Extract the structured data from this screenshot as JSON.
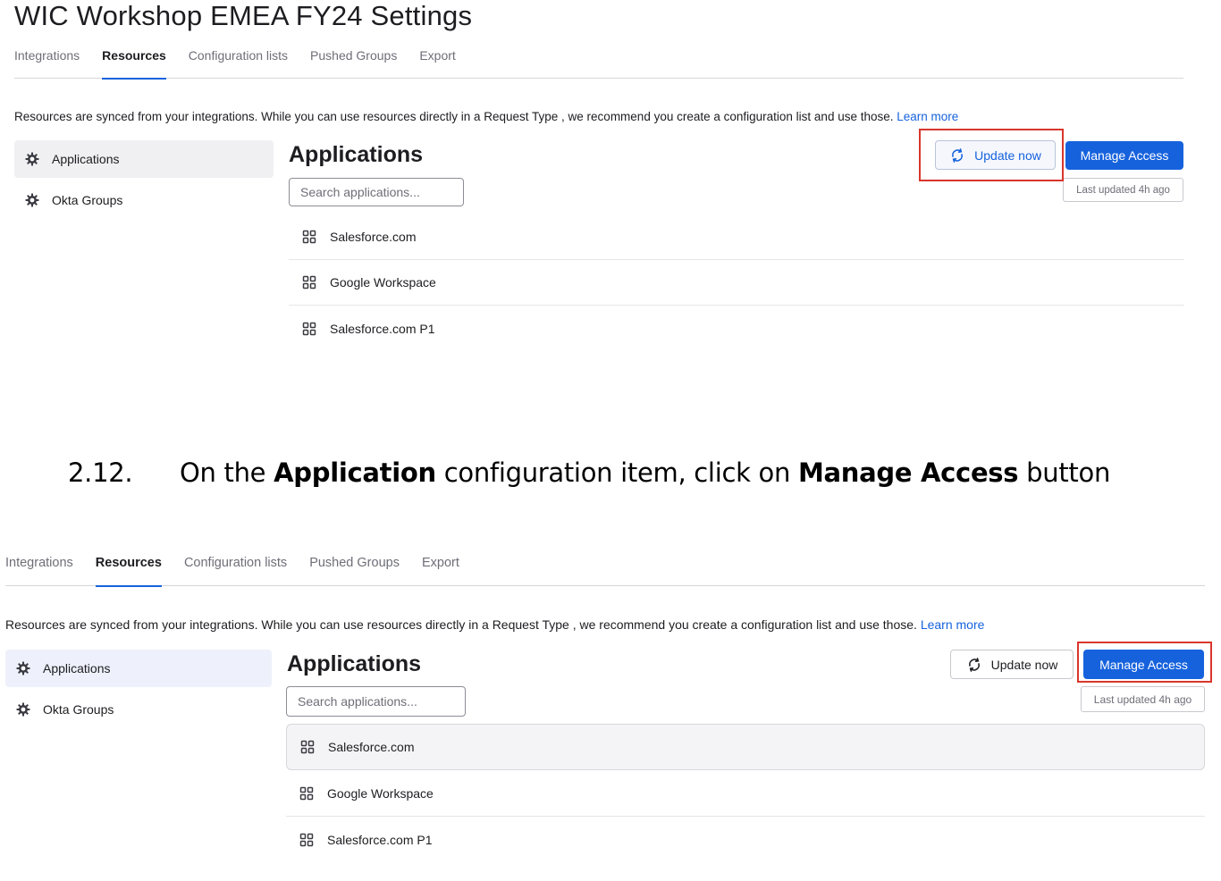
{
  "shot1": {
    "page_title": "WIC Workshop EMEA FY24 Settings",
    "tabs": [
      "Integrations",
      "Resources",
      "Configuration lists",
      "Pushed Groups",
      "Export"
    ],
    "active_tab": "Resources",
    "info_text": "Resources are synced from your integrations. While you can use resources directly in a Request Type , we recommend you create a configuration list and use those.",
    "learn_more": "Learn more",
    "sidebar": [
      "Applications",
      "Okta Groups"
    ],
    "section_title": "Applications",
    "search_placeholder": "Search applications...",
    "apps": [
      "Salesforce.com",
      "Google Workspace",
      "Salesforce.com P1"
    ],
    "update_button": "Update now",
    "manage_button": "Manage Access",
    "last_updated": "Last updated 4h ago"
  },
  "step": {
    "number": "2.12.",
    "text_1": "On the ",
    "bold_1": "Application",
    "text_2": " configuration item, click on ",
    "bold_2": "Manage Access",
    "text_3": " button"
  },
  "shot2": {
    "tabs": [
      "Integrations",
      "Resources",
      "Configuration lists",
      "Pushed Groups",
      "Export"
    ],
    "active_tab": "Resources",
    "info_text": "Resources are synced from your integrations. While you can use resources directly in a Request Type , we recommend you create a configuration list and use those.",
    "learn_more": "Learn more",
    "sidebar": [
      "Applications",
      "Okta Groups"
    ],
    "section_title": "Applications",
    "search_placeholder": "Search applications...",
    "apps": [
      "Salesforce.com",
      "Google Workspace",
      "Salesforce.com P1"
    ],
    "update_button": "Update now",
    "manage_button": "Manage Access",
    "last_updated": "Last updated 4h ago"
  },
  "colors": {
    "accent": "#1662dd",
    "highlight_box": "#d9362b"
  },
  "icons": {
    "sidebar": "gear-icon",
    "app": "app-grid-icon",
    "update": "sync-icon"
  }
}
